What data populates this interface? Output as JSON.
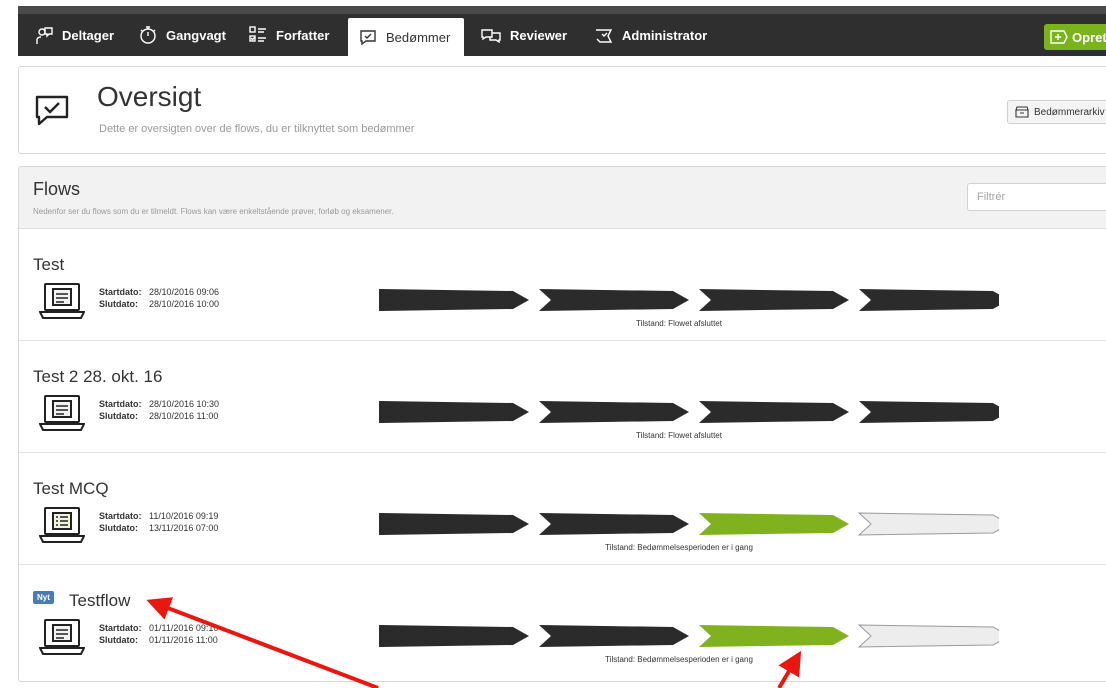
{
  "nav": {
    "tabs": [
      {
        "label": "Deltager",
        "icon": "participant-icon"
      },
      {
        "label": "Gangvagt",
        "icon": "stopwatch-icon"
      },
      {
        "label": "Forfatter",
        "icon": "checklist-icon"
      },
      {
        "label": "Bedømmer",
        "icon": "speech-check-icon",
        "active": true
      },
      {
        "label": "Reviewer",
        "icon": "speech-bubbles-icon"
      },
      {
        "label": "Administrator",
        "icon": "admin-bubble-icon"
      }
    ],
    "create_label": "Opret",
    "create_icon": "plus-arrow-icon",
    "accent_color": "#7bb31b"
  },
  "header": {
    "title": "Oversigt",
    "subtitle": "Dette er oversigten over de flows, du er tilknyttet som bedømmer",
    "archive_label": "Bedømmerarkiv",
    "archive_icon": "archive-box-icon"
  },
  "flows": {
    "title": "Flows",
    "description": "Nedenfor ser du flows som du er tilmeldt. Flows kan være enkeltstående prøver, forløb og eksamener.",
    "filter_placeholder": "Filtrér",
    "start_label": "Startdato:",
    "end_label": "Slutdato:",
    "items": [
      {
        "title": "Test",
        "badge": "",
        "icon": "laptop-document-icon",
        "start": "28/10/2016 09:06",
        "end": "28/10/2016 10:00",
        "steps": [
          "done",
          "done",
          "done",
          "done"
        ],
        "status": "Tilstand: Flowet afsluttet"
      },
      {
        "title": "Test 2 28. okt. 16",
        "badge": "",
        "icon": "laptop-document-icon",
        "start": "28/10/2016 10:30",
        "end": "28/10/2016 11:00",
        "steps": [
          "done",
          "done",
          "done",
          "done"
        ],
        "status": "Tilstand: Flowet afsluttet"
      },
      {
        "title": "Test MCQ",
        "badge": "",
        "icon": "laptop-quiz-icon",
        "start": "11/10/2016 09:19",
        "end": "13/11/2016 07:00",
        "steps": [
          "done",
          "done",
          "active",
          "pending"
        ],
        "status": "Tilstand: Bedømmelsesperioden er i gang"
      },
      {
        "title": "Testflow",
        "badge": "Nyt",
        "icon": "laptop-document-icon",
        "start": "01/11/2016 09:10",
        "end": "01/11/2016 11:00",
        "steps": [
          "done",
          "done",
          "active",
          "pending"
        ],
        "status": "Tilstand: Bedømmelsesperioden er i gang"
      }
    ]
  },
  "colors": {
    "step_done": "#2b2b2b",
    "step_active": "#7fb21e",
    "step_pending": "#ededed",
    "annotation": "#e8170f"
  }
}
